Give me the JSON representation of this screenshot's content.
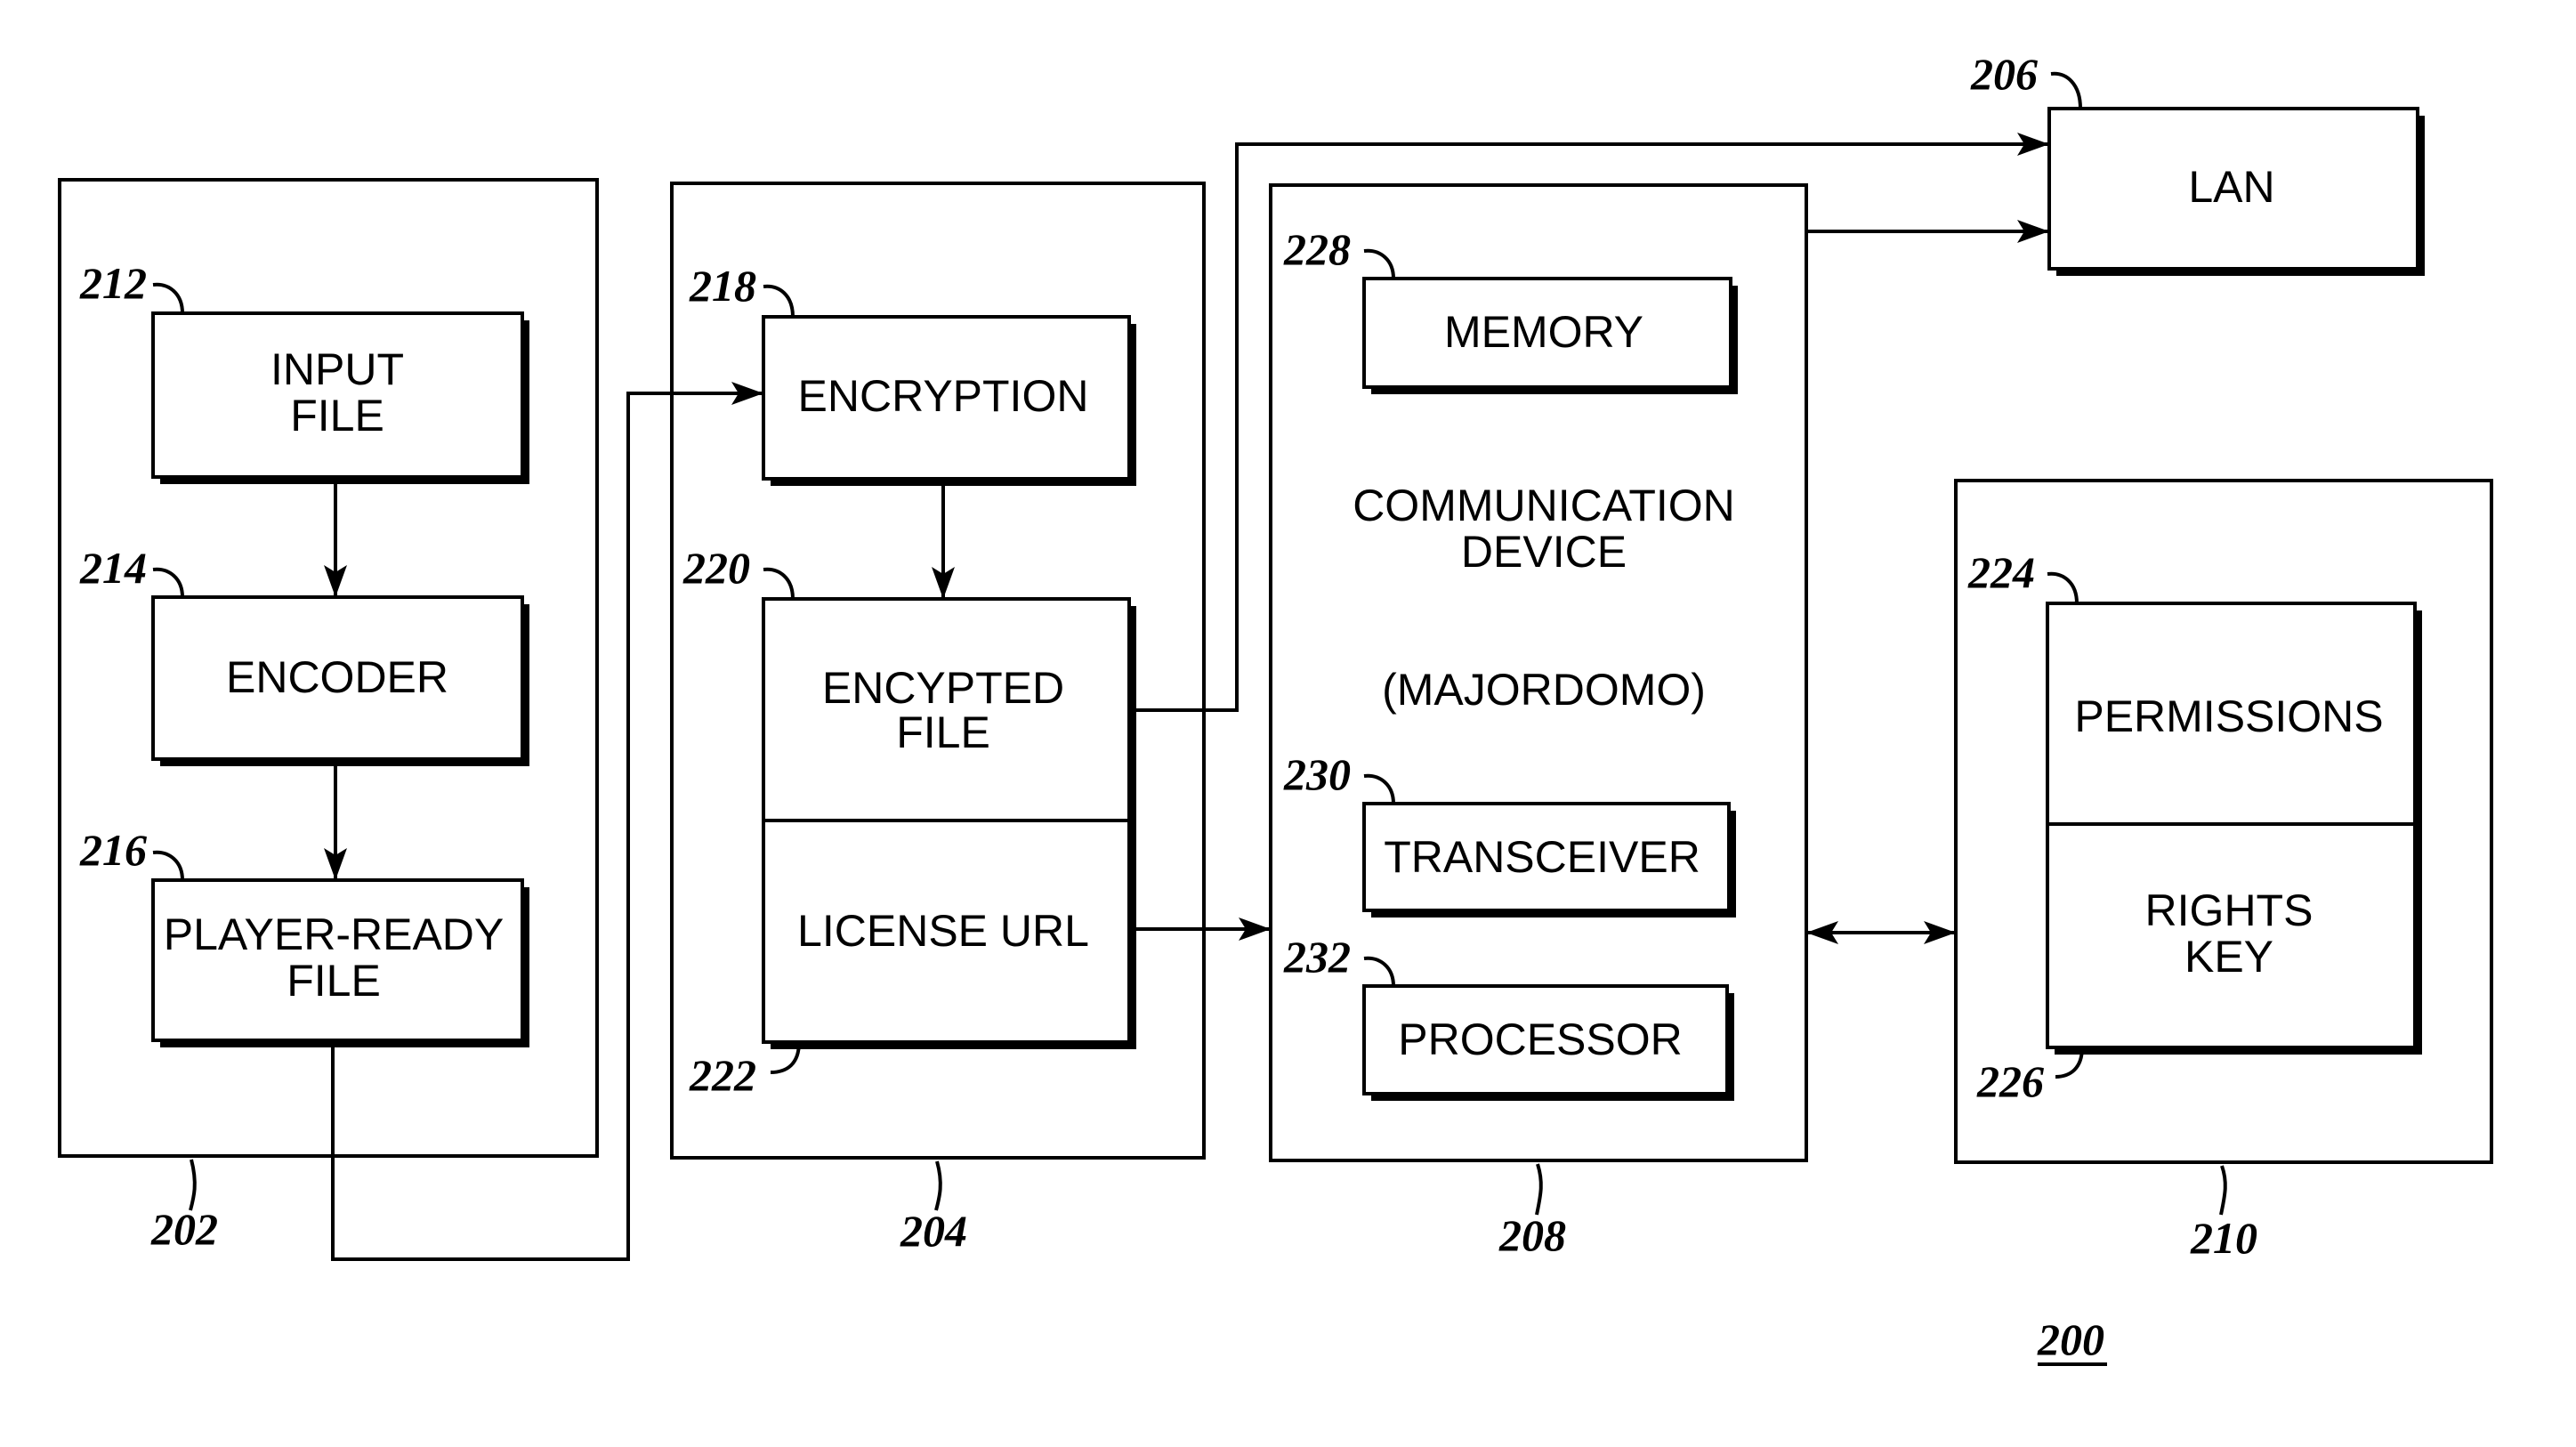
{
  "figure": {
    "ref": "200"
  },
  "groups": {
    "g202": {
      "ref": "202"
    },
    "g204": {
      "ref": "204"
    },
    "g208": {
      "ref": "208",
      "title_lines": [
        "COMMUNICATION",
        "DEVICE"
      ],
      "subtitle": "(MAJORDOMO)"
    },
    "g210": {
      "ref": "210"
    }
  },
  "blocks": {
    "input_file": {
      "ref": "212",
      "lines": [
        "INPUT",
        "FILE"
      ]
    },
    "encoder": {
      "ref": "214",
      "lines": [
        "ENCODER"
      ]
    },
    "player_ready_file": {
      "ref": "216",
      "lines": [
        "PLAYER-READY",
        "FILE"
      ]
    },
    "encryption": {
      "ref": "218",
      "lines": [
        "ENCRYPTION"
      ]
    },
    "encrypted_file": {
      "ref": "220",
      "lines": [
        "ENCYPTED",
        "FILE"
      ]
    },
    "license_url": {
      "ref": "222",
      "lines": [
        "LICENSE URL"
      ]
    },
    "lan": {
      "ref": "206",
      "lines": [
        "LAN"
      ]
    },
    "memory": {
      "ref": "228",
      "lines": [
        "MEMORY"
      ]
    },
    "transceiver": {
      "ref": "230",
      "lines": [
        "TRANSCEIVER"
      ]
    },
    "processor": {
      "ref": "232",
      "lines": [
        "PROCESSOR"
      ]
    },
    "permissions": {
      "ref": "224",
      "lines": [
        "PERMISSIONS"
      ]
    },
    "rights_key": {
      "ref": "226",
      "lines": [
        "RIGHTS",
        "KEY"
      ]
    }
  },
  "connections": [
    {
      "from": "input_file",
      "to": "encoder",
      "type": "arrow"
    },
    {
      "from": "encoder",
      "to": "player_ready_file",
      "type": "arrow"
    },
    {
      "from": "player_ready_file",
      "to": "encryption",
      "type": "arrow"
    },
    {
      "from": "encryption",
      "to": "encrypted_file",
      "type": "arrow"
    },
    {
      "from": "encrypted_file",
      "to": "lan",
      "type": "arrow"
    },
    {
      "from": "g208",
      "to": "lan",
      "type": "arrow"
    },
    {
      "from": "license_url",
      "to": "g208",
      "type": "arrow"
    },
    {
      "from": "g208",
      "to": "g210",
      "type": "bidirectional"
    }
  ]
}
